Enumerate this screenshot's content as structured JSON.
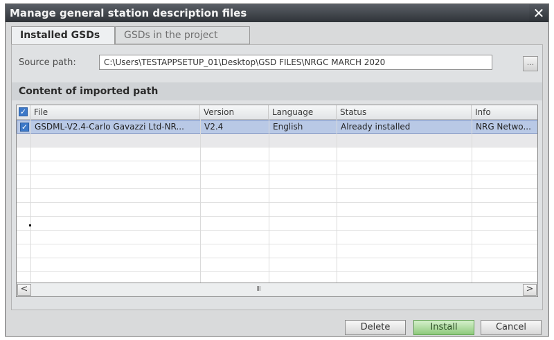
{
  "window": {
    "title": "Manage general station description files",
    "close_glyph": "✕"
  },
  "tabs": [
    {
      "label": "Installed GSDs",
      "active": true
    },
    {
      "label": "GSDs in the project",
      "active": false
    }
  ],
  "source": {
    "label": "Source path:",
    "value": "C:\\Users\\TESTAPPSETUP_01\\Desktop\\GSD FILES\\NRGC MARCH 2020",
    "browse_label": "..."
  },
  "content": {
    "title": "Content of imported path",
    "columns": [
      "File",
      "Version",
      "Language",
      "Status",
      "Info"
    ],
    "rows": [
      {
        "checked": true,
        "file": "GSDML-V2.4-Carlo Gavazzi Ltd-NR...",
        "version": "V2.4",
        "language": "English",
        "status": "Already installed",
        "info": "NRG Netwo..."
      }
    ]
  },
  "scrollbar": {
    "left_glyph": "<",
    "right_glyph": ">",
    "thumb_glyph": "III"
  },
  "buttons": {
    "delete": "Delete",
    "install": "Install",
    "cancel": "Cancel"
  },
  "colors": {
    "selection": "#b9c9e6",
    "install_green": "#8ec97c",
    "checkbox_blue": "#3c78c8"
  }
}
